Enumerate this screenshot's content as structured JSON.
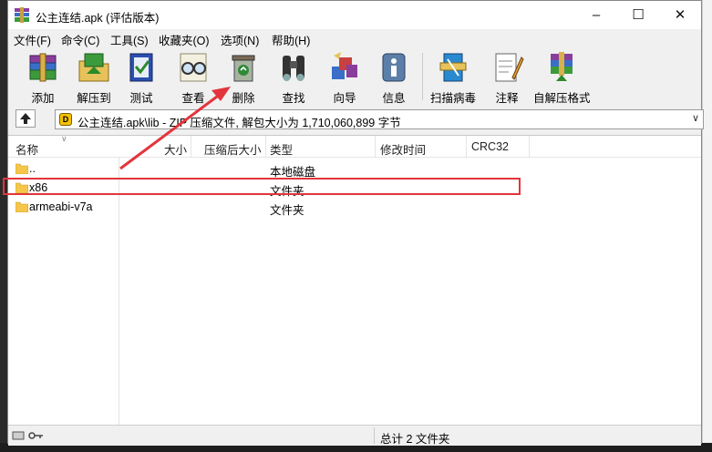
{
  "window": {
    "title": "公主连结.apk (评估版本)"
  },
  "title_buttons": [
    "minimize-icon",
    "maximize-icon",
    "close-icon"
  ],
  "menu": [
    "文件(F)",
    "命令(C)",
    "工具(S)",
    "收藏夹(O)",
    "选项(N)",
    "帮助(H)"
  ],
  "toolbar": {
    "add": "添加",
    "extract": "解压到",
    "test": "测试",
    "view": "查看",
    "delete": "删除",
    "find": "查找",
    "wizard": "向导",
    "info": "信息",
    "scan": "扫描病毒",
    "comment": "注释",
    "sfx": "自解压格式"
  },
  "address": {
    "path": "公主连结.apk\\lib - ZIP 压缩文件, 解包大小为 1,710,060,899 字节"
  },
  "columns": {
    "name": "名称",
    "size": "大小",
    "packed": "压缩后大小",
    "type": "类型",
    "modified": "修改时间",
    "crc": "CRC32"
  },
  "files": [
    {
      "name": "..",
      "type": "本地磁盘"
    },
    {
      "name": "x86",
      "type": "文件夹"
    },
    {
      "name": "armeabi-v7a",
      "type": "文件夹"
    }
  ],
  "status": {
    "summary": "总计 2 文件夹"
  },
  "colors": {
    "annotation_red": "#e2353d",
    "folder_yellow": "#f5c64a"
  }
}
